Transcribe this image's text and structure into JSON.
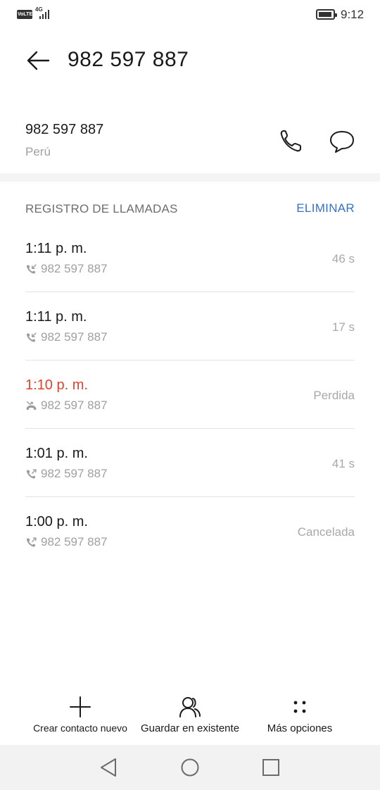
{
  "status_bar": {
    "volte": "VoLTE",
    "network": "4G",
    "time": "9:12"
  },
  "header": {
    "title": "982 597 887",
    "back_icon": "arrow-left-icon"
  },
  "contact": {
    "number": "982 597 887",
    "country": "Perú",
    "call_icon": "phone-icon",
    "message_icon": "chat-bubble-icon"
  },
  "call_log": {
    "heading": "REGISTRO DE LLAMADAS",
    "delete_label": "ELIMINAR",
    "entries": [
      {
        "time": "1:11 p. m.",
        "number": "982 597 887",
        "duration": "46 s",
        "type": "incoming",
        "icon": "incoming-call-icon"
      },
      {
        "time": "1:11 p. m.",
        "number": "982 597 887",
        "duration": "17 s",
        "type": "incoming",
        "icon": "incoming-call-icon"
      },
      {
        "time": "1:10 p. m.",
        "number": "982 597 887",
        "duration": "Perdida",
        "type": "missed",
        "icon": "missed-call-icon"
      },
      {
        "time": "1:01 p. m.",
        "number": "982 597 887",
        "duration": "41 s",
        "type": "outgoing",
        "icon": "outgoing-call-icon"
      },
      {
        "time": "1:00 p. m.",
        "number": "982 597 887",
        "duration": "Cancelada",
        "type": "outgoing",
        "icon": "outgoing-call-icon"
      }
    ]
  },
  "bottom_actions": {
    "new_contact": "Crear contacto nuevo",
    "save_existing": "Guardar en existente",
    "more_options": "Más opciones"
  },
  "colors": {
    "accent": "#2e73d4",
    "missed": "#e0412f",
    "secondary_text": "#a0a0a0"
  }
}
